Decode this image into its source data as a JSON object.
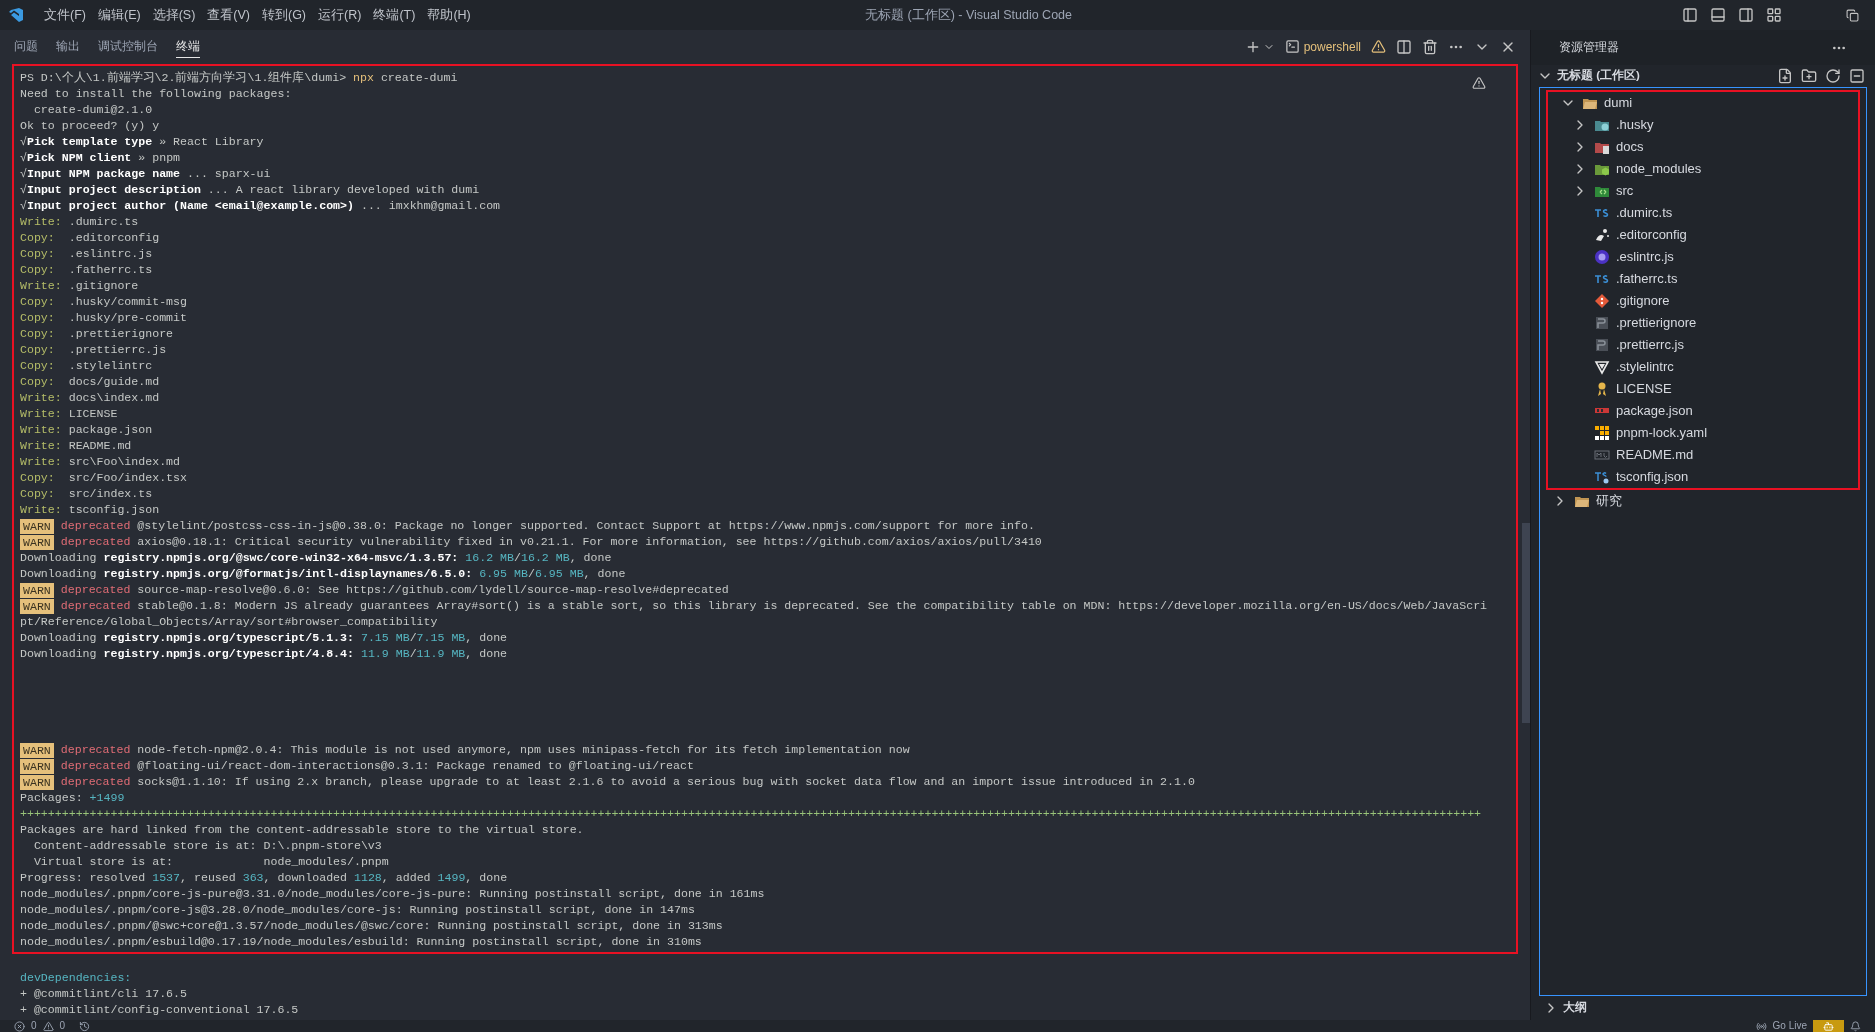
{
  "window": {
    "title": "无标题 (工作区) - Visual Studio Code"
  },
  "menu": [
    "文件(F)",
    "编辑(E)",
    "选择(S)",
    "查看(V)",
    "转到(G)",
    "运行(R)",
    "终端(T)",
    "帮助(H)"
  ],
  "panel_tabs": [
    {
      "label": "问题",
      "selected": false
    },
    {
      "label": "输出",
      "selected": false
    },
    {
      "label": "调试控制台",
      "selected": false
    },
    {
      "label": "终端",
      "selected": true
    }
  ],
  "terminal_toolbar": {
    "shell": "powershell"
  },
  "terminal": {
    "highlighted_lines": [
      {
        "kind": "text",
        "segments": [
          {
            "kind": "plain",
            "text": "PS D:\\个人\\1.前端学习\\2.前端方向学习\\1.组件库\\dumi> "
          },
          {
            "kind": "command",
            "text": "npx"
          },
          {
            "kind": "plain",
            "text": " create-dumi"
          }
        ]
      },
      {
        "kind": "text",
        "segments": [
          {
            "kind": "plain",
            "text": "Need to install the following packages:"
          }
        ]
      },
      {
        "kind": "text",
        "segments": [
          {
            "kind": "plain",
            "text": "  create-dumi@2.1.0"
          }
        ]
      },
      {
        "kind": "text",
        "segments": [
          {
            "kind": "plain",
            "text": "Ok to proceed? (y) y"
          }
        ]
      },
      {
        "kind": "text",
        "segments": [
          {
            "kind": "plain",
            "text": "√"
          },
          {
            "kind": "bold",
            "text": "Pick template type"
          },
          {
            "kind": "plain",
            "text": " » React Library"
          }
        ]
      },
      {
        "kind": "text",
        "segments": [
          {
            "kind": "plain",
            "text": "√"
          },
          {
            "kind": "bold",
            "text": "Pick NPM client"
          },
          {
            "kind": "plain",
            "text": " » pnpm"
          }
        ]
      },
      {
        "kind": "text",
        "segments": [
          {
            "kind": "plain",
            "text": "√"
          },
          {
            "kind": "bold",
            "text": "Input NPM package name"
          },
          {
            "kind": "plain",
            "text": " ... sparx-ui"
          }
        ]
      },
      {
        "kind": "text",
        "segments": [
          {
            "kind": "plain",
            "text": "√"
          },
          {
            "kind": "bold",
            "text": "Input project description"
          },
          {
            "kind": "plain",
            "text": " ... A react library developed with dumi"
          }
        ]
      },
      {
        "kind": "text",
        "segments": [
          {
            "kind": "plain",
            "text": "√"
          },
          {
            "kind": "bold",
            "text": "Input project author (Name <email@example.com>)"
          },
          {
            "kind": "plain",
            "text": " ... imxkhm@gmail.com"
          }
        ]
      },
      {
        "kind": "text",
        "segments": [
          {
            "kind": "label",
            "text": "Write:"
          },
          {
            "kind": "plain",
            "text": " .dumirc.ts"
          }
        ]
      },
      {
        "kind": "text",
        "segments": [
          {
            "kind": "label",
            "text": "Copy:"
          },
          {
            "kind": "plain",
            "text": "  .editorconfig"
          }
        ]
      },
      {
        "kind": "text",
        "segments": [
          {
            "kind": "label",
            "text": "Copy:"
          },
          {
            "kind": "plain",
            "text": "  .eslintrc.js"
          }
        ]
      },
      {
        "kind": "text",
        "segments": [
          {
            "kind": "label",
            "text": "Copy:"
          },
          {
            "kind": "plain",
            "text": "  .fatherrc.ts"
          }
        ]
      },
      {
        "kind": "text",
        "segments": [
          {
            "kind": "label",
            "text": "Write:"
          },
          {
            "kind": "plain",
            "text": " .gitignore"
          }
        ]
      },
      {
        "kind": "text",
        "segments": [
          {
            "kind": "label",
            "text": "Copy:"
          },
          {
            "kind": "plain",
            "text": "  .husky/commit-msg"
          }
        ]
      },
      {
        "kind": "text",
        "segments": [
          {
            "kind": "label",
            "text": "Copy:"
          },
          {
            "kind": "plain",
            "text": "  .husky/pre-commit"
          }
        ]
      },
      {
        "kind": "text",
        "segments": [
          {
            "kind": "label",
            "text": "Copy:"
          },
          {
            "kind": "plain",
            "text": "  .prettierignore"
          }
        ]
      },
      {
        "kind": "text",
        "segments": [
          {
            "kind": "label",
            "text": "Copy:"
          },
          {
            "kind": "plain",
            "text": "  .prettierrc.js"
          }
        ]
      },
      {
        "kind": "text",
        "segments": [
          {
            "kind": "label",
            "text": "Copy:"
          },
          {
            "kind": "plain",
            "text": "  .stylelintrc"
          }
        ]
      },
      {
        "kind": "text",
        "segments": [
          {
            "kind": "label",
            "text": "Copy:"
          },
          {
            "kind": "plain",
            "text": "  docs/guide.md"
          }
        ]
      },
      {
        "kind": "text",
        "segments": [
          {
            "kind": "label",
            "text": "Write:"
          },
          {
            "kind": "plain",
            "text": " docs\\index.md"
          }
        ]
      },
      {
        "kind": "text",
        "segments": [
          {
            "kind": "label",
            "text": "Write:"
          },
          {
            "kind": "plain",
            "text": " LICENSE"
          }
        ]
      },
      {
        "kind": "text",
        "segments": [
          {
            "kind": "label",
            "text": "Write:"
          },
          {
            "kind": "plain",
            "text": " package.json"
          }
        ]
      },
      {
        "kind": "text",
        "segments": [
          {
            "kind": "label",
            "text": "Write:"
          },
          {
            "kind": "plain",
            "text": " README.md"
          }
        ]
      },
      {
        "kind": "text",
        "segments": [
          {
            "kind": "label",
            "text": "Write:"
          },
          {
            "kind": "plain",
            "text": " src\\Foo\\index.md"
          }
        ]
      },
      {
        "kind": "text",
        "segments": [
          {
            "kind": "label",
            "text": "Copy:"
          },
          {
            "kind": "plain",
            "text": "  src/Foo/index.tsx"
          }
        ]
      },
      {
        "kind": "text",
        "segments": [
          {
            "kind": "label",
            "text": "Copy:"
          },
          {
            "kind": "plain",
            "text": "  src/index.ts"
          }
        ]
      },
      {
        "kind": "text",
        "segments": [
          {
            "kind": "label",
            "text": "Write:"
          },
          {
            "kind": "plain",
            "text": " tsconfig.json"
          }
        ]
      },
      {
        "kind": "text",
        "segments": [
          {
            "kind": "badge",
            "text": "WARN"
          },
          {
            "kind": "deprecated",
            "text": " deprecated"
          },
          {
            "kind": "plain",
            "text": " @stylelint/postcss-css-in-js@0.38.0: Package no longer supported. Contact Support at https://www.npmjs.com/support for more info."
          }
        ]
      },
      {
        "kind": "text",
        "segments": [
          {
            "kind": "badge",
            "text": "WARN"
          },
          {
            "kind": "deprecated",
            "text": " deprecated"
          },
          {
            "kind": "plain",
            "text": " axios@0.18.1: Critical security vulnerability fixed in v0.21.1. For more information, see https://github.com/axios/axios/pull/3410"
          }
        ]
      },
      {
        "kind": "text",
        "segments": [
          {
            "kind": "plain",
            "text": "Downloading "
          },
          {
            "kind": "bold",
            "text": "registry.npmjs.org/@swc/core-win32-x64-msvc/1.3.57:"
          },
          {
            "kind": "number",
            "text": " 16.2 MB"
          },
          {
            "kind": "plain",
            "text": "/"
          },
          {
            "kind": "number",
            "text": "16.2 MB"
          },
          {
            "kind": "plain",
            "text": ", done"
          }
        ]
      },
      {
        "kind": "text",
        "segments": [
          {
            "kind": "plain",
            "text": "Downloading "
          },
          {
            "kind": "bold",
            "text": "registry.npmjs.org/@formatjs/intl-displaynames/6.5.0:"
          },
          {
            "kind": "number",
            "text": " 6.95 MB"
          },
          {
            "kind": "plain",
            "text": "/"
          },
          {
            "kind": "number",
            "text": "6.95 MB"
          },
          {
            "kind": "plain",
            "text": ", done"
          }
        ]
      },
      {
        "kind": "text",
        "segments": [
          {
            "kind": "badge",
            "text": "WARN"
          },
          {
            "kind": "deprecated",
            "text": " deprecated"
          },
          {
            "kind": "plain",
            "text": " source-map-resolve@0.6.0: See https://github.com/lydell/source-map-resolve#deprecated"
          }
        ]
      },
      {
        "kind": "text",
        "segments": [
          {
            "kind": "badge",
            "text": "WARN"
          },
          {
            "kind": "deprecated",
            "text": " deprecated"
          },
          {
            "kind": "plain",
            "text": " stable@0.1.8: Modern JS already guarantees Array#sort() is a stable sort, so this library is deprecated. See the compatibility table on MDN: https://developer.mozilla.org/en-US/docs/Web/JavaScri"
          }
        ]
      },
      {
        "kind": "text",
        "segments": [
          {
            "kind": "plain",
            "text": "pt/Reference/Global_Objects/Array/sort#browser_compatibility"
          }
        ]
      },
      {
        "kind": "text",
        "segments": [
          {
            "kind": "plain",
            "text": "Downloading "
          },
          {
            "kind": "bold",
            "text": "registry.npmjs.org/typescript/5.1.3:"
          },
          {
            "kind": "number",
            "text": " 7.15 MB"
          },
          {
            "kind": "plain",
            "text": "/"
          },
          {
            "kind": "number",
            "text": "7.15 MB"
          },
          {
            "kind": "plain",
            "text": ", done"
          }
        ]
      },
      {
        "kind": "text",
        "segments": [
          {
            "kind": "plain",
            "text": "Downloading "
          },
          {
            "kind": "bold",
            "text": "registry.npmjs.org/typescript/4.8.4:"
          },
          {
            "kind": "number",
            "text": " 11.9 MB"
          },
          {
            "kind": "plain",
            "text": "/"
          },
          {
            "kind": "number",
            "text": "11.9 MB"
          },
          {
            "kind": "plain",
            "text": ", done"
          }
        ]
      },
      {
        "kind": "blank"
      },
      {
        "kind": "blank"
      },
      {
        "kind": "blank"
      },
      {
        "kind": "blank"
      },
      {
        "kind": "blank"
      },
      {
        "kind": "text",
        "segments": [
          {
            "kind": "badge",
            "text": "WARN"
          },
          {
            "kind": "deprecated",
            "text": " deprecated"
          },
          {
            "kind": "plain",
            "text": " node-fetch-npm@2.0.4: This module is not used anymore, npm uses minipass-fetch for its fetch implementation now"
          }
        ]
      },
      {
        "kind": "text",
        "segments": [
          {
            "kind": "badge",
            "text": "WARN"
          },
          {
            "kind": "deprecated",
            "text": " deprecated"
          },
          {
            "kind": "plain",
            "text": " @floating-ui/react-dom-interactions@0.3.1: Package renamed to @floating-ui/react"
          }
        ]
      },
      {
        "kind": "text",
        "segments": [
          {
            "kind": "badge",
            "text": "WARN"
          },
          {
            "kind": "deprecated",
            "text": " deprecated"
          },
          {
            "kind": "plain",
            "text": " socks@1.1.10: If using 2.x branch, please upgrade to at least 2.1.6 to avoid a serious bug with socket data flow and an import issue introduced in 2.1.0"
          }
        ]
      },
      {
        "kind": "text",
        "segments": [
          {
            "kind": "plain",
            "text": "Packages: "
          },
          {
            "kind": "number",
            "text": "+1499"
          }
        ]
      },
      {
        "kind": "text",
        "segments": [
          {
            "kind": "progress",
            "text": "++++++++++++++++++++++++++++++++++++++++++++++++++++++++++++++++++++++++++++++++++++++++++++++++++++++++++++++++++++++++++++++++++++++++++++++++++++++++++++++++++++++++++++++++++++++++++++++++++++++++++++++++++"
          }
        ]
      },
      {
        "kind": "text",
        "segments": [
          {
            "kind": "plain",
            "text": "Packages are hard linked from the content-addressable store to the virtual store."
          }
        ]
      },
      {
        "kind": "text",
        "segments": [
          {
            "kind": "plain",
            "text": "  Content-addressable store is at: D:\\.pnpm-store\\v3"
          }
        ]
      },
      {
        "kind": "text",
        "segments": [
          {
            "kind": "plain",
            "text": "  Virtual store is at:             node_modules/.pnpm"
          }
        ]
      },
      {
        "kind": "text",
        "segments": [
          {
            "kind": "plain",
            "text": "Progress: resolved "
          },
          {
            "kind": "number",
            "text": "1537"
          },
          {
            "kind": "plain",
            "text": ", reused "
          },
          {
            "kind": "number",
            "text": "363"
          },
          {
            "kind": "plain",
            "text": ", downloaded "
          },
          {
            "kind": "number",
            "text": "1128"
          },
          {
            "kind": "plain",
            "text": ", added "
          },
          {
            "kind": "number",
            "text": "1499"
          },
          {
            "kind": "plain",
            "text": ", done"
          }
        ]
      },
      {
        "kind": "text",
        "segments": [
          {
            "kind": "plain",
            "text": "node_modules/.pnpm/core-js-pure@3.31.0/node_modules/core-js-pure: Running postinstall script, done in 161ms"
          }
        ]
      },
      {
        "kind": "text",
        "segments": [
          {
            "kind": "plain",
            "text": "node_modules/.pnpm/core-js@3.28.0/node_modules/core-js: Running postinstall script, done in 147ms"
          }
        ]
      },
      {
        "kind": "text",
        "segments": [
          {
            "kind": "plain",
            "text": "node_modules/.pnpm/@swc+core@1.3.57/node_modules/@swc/core: Running postinstall script, done in 313ms"
          }
        ]
      },
      {
        "kind": "text",
        "segments": [
          {
            "kind": "plain",
            "text": "node_modules/.pnpm/esbuild@0.17.19/node_modules/esbuild: Running postinstall script, done in 310ms"
          }
        ]
      }
    ],
    "lines_after": [
      {
        "kind": "blank"
      },
      {
        "kind": "text",
        "segments": [
          {
            "kind": "number",
            "text": "devDependencies:"
          }
        ]
      },
      {
        "kind": "text",
        "segments": [
          {
            "kind": "plain",
            "text": "+ @commitlint/cli 17.6.5"
          }
        ]
      },
      {
        "kind": "text",
        "segments": [
          {
            "kind": "plain",
            "text": "+ @commitlint/config-conventional 17.6.5"
          }
        ]
      }
    ]
  },
  "explorer": {
    "title": "资源管理器",
    "workspace": {
      "name": "无标题 (工作区)",
      "expanded": true
    },
    "tree": [
      {
        "kind": "plain-folder",
        "name": "dumi",
        "expanded": true,
        "highlighted": true,
        "children": [
          {
            "kind": "husky-folder",
            "name": ".husky",
            "expanded": false
          },
          {
            "kind": "docs-folder",
            "name": "docs",
            "expanded": false
          },
          {
            "kind": "modules-folder",
            "name": "node_modules",
            "expanded": false
          },
          {
            "kind": "src-folder",
            "name": "src",
            "expanded": false
          },
          {
            "kind": "ts",
            "name": ".dumirc.ts"
          },
          {
            "kind": "editorconfig",
            "name": ".editorconfig"
          },
          {
            "kind": "eslint",
            "name": ".eslintrc.js"
          },
          {
            "kind": "ts",
            "name": ".fatherrc.ts"
          },
          {
            "kind": "git",
            "name": ".gitignore"
          },
          {
            "kind": "prettier",
            "name": ".prettierignore"
          },
          {
            "kind": "prettier",
            "name": ".prettierrc.js"
          },
          {
            "kind": "stylelint",
            "name": ".stylelintrc"
          },
          {
            "kind": "license",
            "name": "LICENSE"
          },
          {
            "kind": "npm",
            "name": "package.json"
          },
          {
            "kind": "pnpm",
            "name": "pnpm-lock.yaml"
          },
          {
            "kind": "markdown",
            "name": "README.md"
          },
          {
            "kind": "tsconfig",
            "name": "tsconfig.json"
          }
        ]
      },
      {
        "kind": "plain-folder",
        "name": "研究",
        "expanded": false,
        "highlighted": false
      }
    ],
    "outline": {
      "title": "大纲",
      "expanded": false
    }
  },
  "status_bar": {
    "errors": "0",
    "warnings": "0",
    "go_live": "Go Live"
  }
}
